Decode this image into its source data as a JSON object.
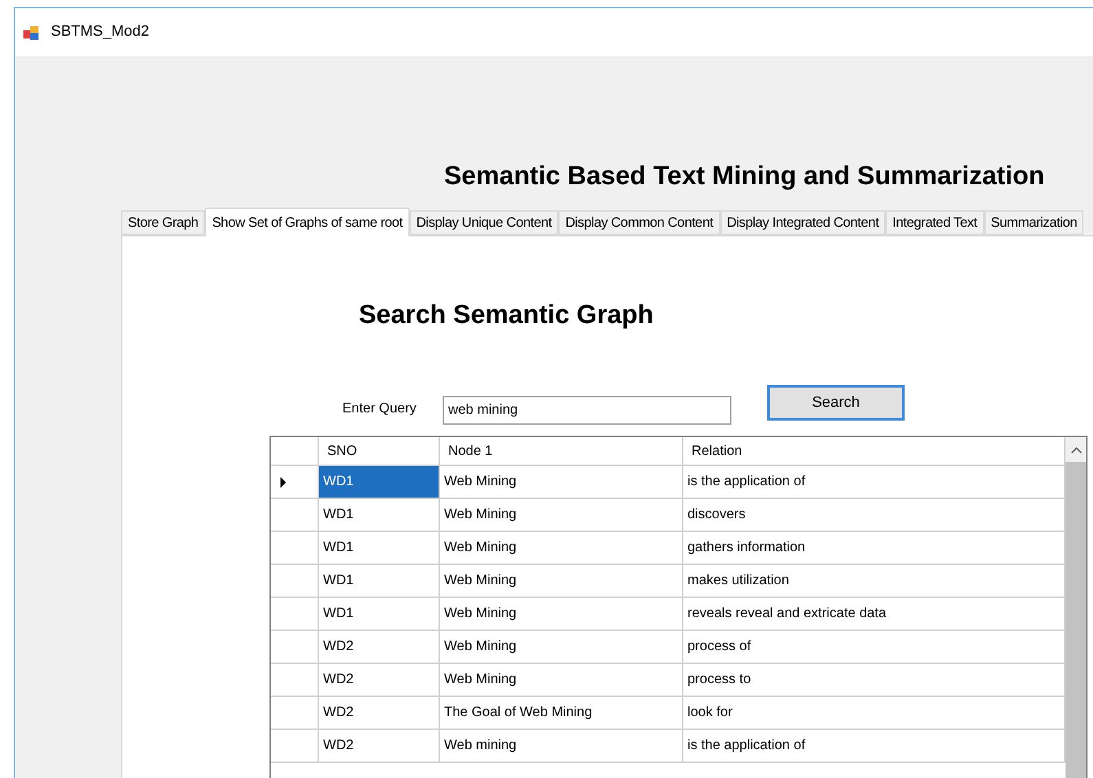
{
  "window": {
    "title": "SBTMS_Mod2"
  },
  "heading": "Semantic Based Text Mining and Summarization",
  "tabs": [
    {
      "label": "Store Graph",
      "selected": false
    },
    {
      "label": "Show Set of Graphs of same root",
      "selected": true
    },
    {
      "label": "Display Unique Content",
      "selected": false
    },
    {
      "label": "Display Common Content",
      "selected": false
    },
    {
      "label": "Display Integrated Content",
      "selected": false
    },
    {
      "label": "Integrated Text",
      "selected": false
    },
    {
      "label": "Summarization",
      "selected": false
    }
  ],
  "panel": {
    "title": "Search Semantic Graph",
    "query_label": "Enter Query",
    "query_value": "web mining",
    "search_button": "Search"
  },
  "table": {
    "columns": [
      "SNO",
      "Node 1",
      "Relation"
    ],
    "rows": [
      {
        "cells": [
          "WD1",
          "Web Mining",
          "is the application of"
        ],
        "selected": true
      },
      {
        "cells": [
          "WD1",
          "Web Mining",
          "discovers"
        ],
        "selected": false
      },
      {
        "cells": [
          "WD1",
          "Web Mining",
          "gathers information"
        ],
        "selected": false
      },
      {
        "cells": [
          "WD1",
          "Web Mining",
          "makes utilization"
        ],
        "selected": false
      },
      {
        "cells": [
          "WD1",
          "Web Mining",
          "reveals reveal and extricate data"
        ],
        "selected": false
      },
      {
        "cells": [
          "WD2",
          "Web Mining",
          "process of"
        ],
        "selected": false
      },
      {
        "cells": [
          "WD2",
          "Web Mining",
          "process to"
        ],
        "selected": false
      },
      {
        "cells": [
          "WD2",
          "The Goal of Web Mining",
          "look for"
        ],
        "selected": false
      },
      {
        "cells": [
          "WD2",
          "Web mining",
          "is the application of"
        ],
        "selected": false
      }
    ]
  }
}
